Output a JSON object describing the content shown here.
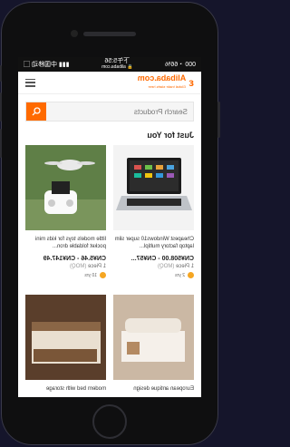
{
  "status": {
    "carrier_left": "000",
    "battery": "66%",
    "time": "下午5:56",
    "domain": "alibaba.com",
    "carrier_right": "中国移动"
  },
  "header": {
    "logo_text": "Alibaba.com",
    "logo_tagline": "Global trade starts here"
  },
  "search": {
    "placeholder": "Search Products"
  },
  "section": {
    "title": "Just for You"
  },
  "products": [
    {
      "title": "Cheapest Windows10 super slim laptop factory multipl...",
      "price": "CN¥508.00 - CN¥57...",
      "moq": "1 Piece",
      "moq_unit": "(MOQ)",
      "yrs": "2 yrs"
    },
    {
      "title": "little models toys for kids mini pocket foldable dron...",
      "price": "CN¥5.46 - CN¥147.49",
      "moq": "1 Piece",
      "moq_unit": "(MOQ)",
      "yrs": "10 yrs"
    },
    {
      "title": "European antique design",
      "price": "",
      "moq": "",
      "moq_unit": "",
      "yrs": ""
    },
    {
      "title": "modern bed with storage",
      "price": "",
      "moq": "",
      "moq_unit": "",
      "yrs": ""
    }
  ],
  "colors": {
    "brand": "#ff6a00",
    "phone": "#0f0f10",
    "background": "#15152b"
  }
}
